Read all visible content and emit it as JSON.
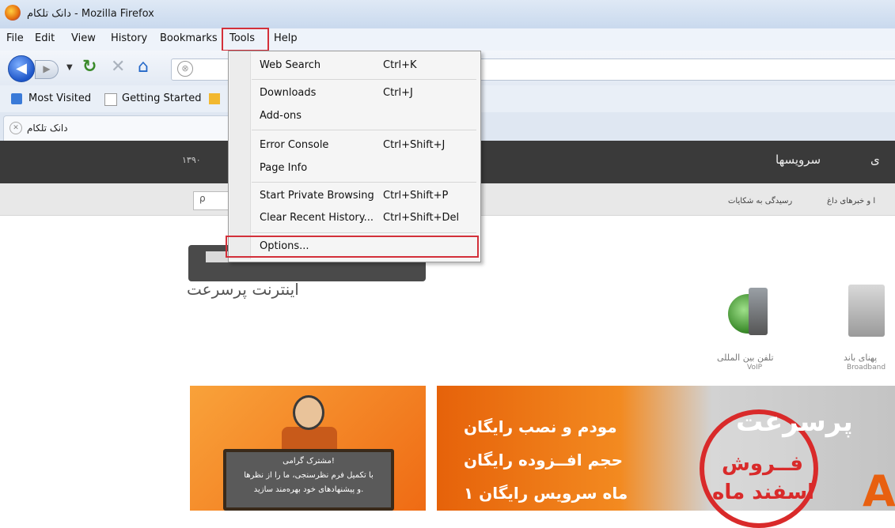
{
  "window": {
    "title": "دانک تلکام - Mozilla Firefox"
  },
  "menubar": {
    "items": [
      "File",
      "Edit",
      "View",
      "History",
      "Bookmarks",
      "Tools",
      "Help"
    ]
  },
  "nav": {
    "url_icon": "⊗"
  },
  "bookmarks": {
    "items": [
      "Most Visited",
      "Getting Started"
    ]
  },
  "tab": {
    "title": "دانک تلکام"
  },
  "tools_menu": {
    "items": [
      {
        "label": "Web Search",
        "shortcut": "Ctrl+K"
      },
      {
        "label": "Downloads",
        "shortcut": "Ctrl+J"
      },
      {
        "label": "Add-ons",
        "shortcut": ""
      },
      {
        "label": "Error Console",
        "shortcut": "Ctrl+Shift+J"
      },
      {
        "label": "Page Info",
        "shortcut": ""
      },
      {
        "label": "Start Private Browsing",
        "shortcut": "Ctrl+Shift+P"
      },
      {
        "label": "Clear Recent History...",
        "shortcut": "Ctrl+Shift+Del"
      },
      {
        "label": "Options...",
        "shortcut": ""
      }
    ]
  },
  "page": {
    "dark_band": {
      "number": "۱۳۹۰",
      "menu_1": "سرویسها",
      "menu_2": "ی"
    },
    "search_icon": "ρ",
    "grey_links": [
      "رسیدگی به شکایات",
      "ا و خبرهای داغ"
    ],
    "logo": {
      "tagline": "اینترنت پرسرعت"
    },
    "services": [
      {
        "label_fa": "تلفن بین المللی",
        "label_en": "VoIP"
      },
      {
        "label_fa": "پهنای باند",
        "label_en": "Broadband"
      }
    ],
    "banner1": {
      "lines": [
        "مشترک گرامی!",
        "با تکمیل فرم نظرسنجی، ما را از نظرها",
        "و پیشنهادهای خود بهره‌مند سازید."
      ]
    },
    "banner2": {
      "lines": [
        "مودم و نصب رایگان",
        "حجم افــزوده رایگان",
        "۱ ماه سرویس رایگان"
      ],
      "headline": "پرسرعت",
      "stamp_1": "فــروش",
      "stamp_2": "اسفند ماه",
      "letter": "A"
    }
  },
  "colors": {
    "highlight_red": "#d3303a",
    "dark_band": "#3a3a3a",
    "orange": "#ef6b14"
  }
}
